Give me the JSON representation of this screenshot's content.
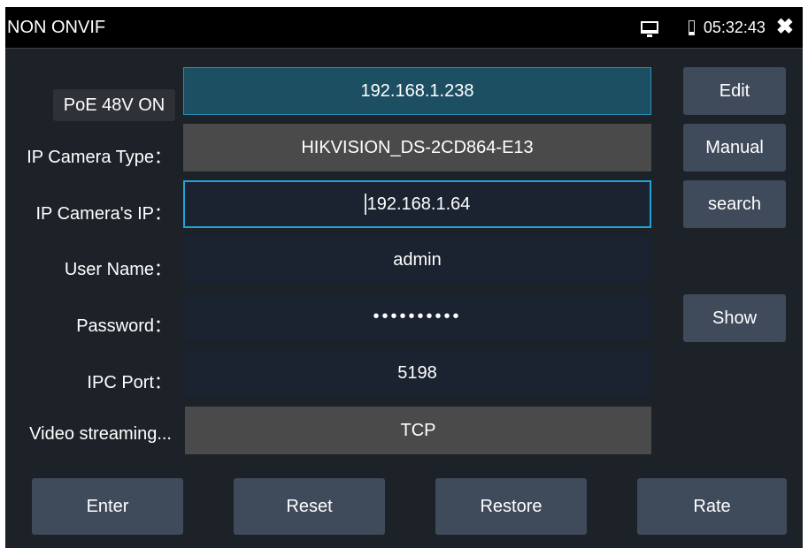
{
  "header": {
    "title": "NON ONVIF",
    "time": "05:32:43",
    "monitor_icon": "monitor-icon",
    "battery_icon": "battery-icon",
    "close_icon": "close-icon",
    "close_glyph": "✖"
  },
  "poe_label": "PoE 48V ON",
  "top_ip": "192.168.1.238",
  "form": {
    "camera_type_label": "IP Camera Type：",
    "camera_type_value": "HIKVISION_DS-2CD864-E13",
    "camera_ip_label": "IP Camera's IP：",
    "camera_ip_value": "192.168.1.64",
    "user_name_label": "User Name：",
    "user_name_value": "admin",
    "password_label": "Password：",
    "password_value": "••••••••••",
    "ipc_port_label": "IPC Port：",
    "ipc_port_value": "5198",
    "video_streaming_label": "Video streaming...",
    "video_streaming_value": "TCP"
  },
  "side_buttons": {
    "edit": "Edit",
    "manual": "Manual",
    "search": "search",
    "show": "Show"
  },
  "bottom_buttons": {
    "enter": "Enter",
    "reset": "Reset",
    "restore": "Restore",
    "rate": "Rate"
  },
  "colors": {
    "background": "#1d2228",
    "button": "#3f4a5b",
    "focus_border": "#1fa3d8",
    "selected_field": "#1d4f63"
  }
}
